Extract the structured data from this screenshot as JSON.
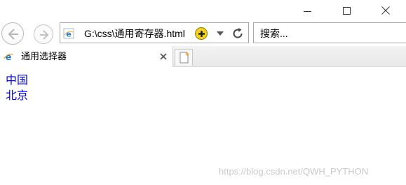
{
  "window": {
    "controls": [
      "minimize",
      "maximize",
      "close"
    ]
  },
  "nav": {
    "back_icon": "back-arrow-icon",
    "forward_icon": "forward-arrow-icon"
  },
  "addressbar": {
    "url": "G:\\css\\通用寄存器.html",
    "favicon": "ie-icon",
    "addon_icon": "plus-addon-icon",
    "refresh_icon": "refresh-icon"
  },
  "search": {
    "placeholder": "搜索..."
  },
  "tabs": [
    {
      "title": "通用选择器",
      "icon": "ie-icon",
      "active": true
    }
  ],
  "content": {
    "lines": [
      "中国",
      "北京"
    ],
    "text_color": "#0000ff"
  },
  "watermark": "https://blog.csdn.net/QWH_PYTHON"
}
